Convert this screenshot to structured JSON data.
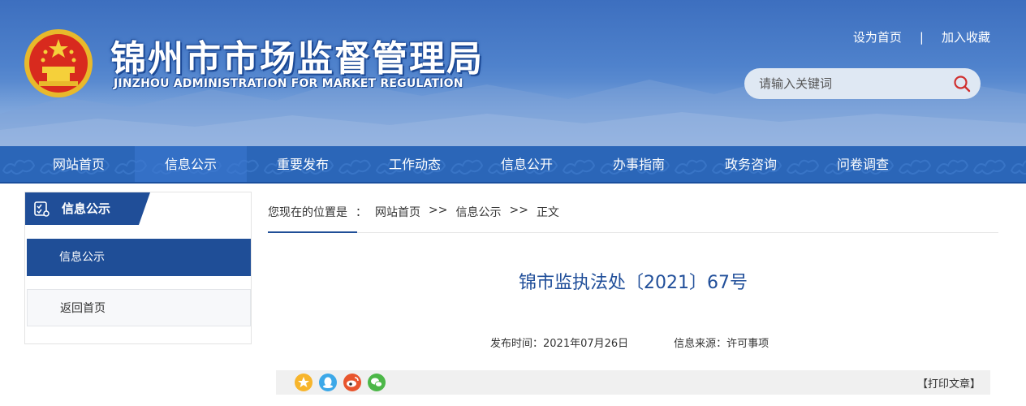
{
  "header": {
    "title": "锦州市市场监督管理局",
    "subtitle": "JINZHOU ADMINISTRATION FOR MARKET REGULATION",
    "links": [
      "设为首页",
      "|",
      "加入收藏"
    ],
    "search": {
      "placeholder": "请输入关键词",
      "icon": "search-icon"
    }
  },
  "nav": {
    "items": [
      "网站首页",
      "信息公示",
      "重要发布",
      "工作动态",
      "信息公开",
      "办事指南",
      "政务咨询",
      "问卷调查"
    ],
    "active_index": 1
  },
  "sidebar": {
    "heading": "信息公示",
    "heading_icon": "checklist-icon",
    "items": [
      "信息公示",
      "返回首页"
    ]
  },
  "breadcrumb": {
    "prefix": "您现在的位置是",
    "colon": "：",
    "items": [
      "网站首页",
      "信息公示",
      "正文"
    ],
    "separator": ">>"
  },
  "article": {
    "title": "锦市监执法处〔2021〕67号",
    "publish_time": "发布时间：2021年07月26日",
    "source": "信息来源：许可事项"
  },
  "share": {
    "icons": [
      "qzone-icon",
      "qq-icon",
      "weibo-icon",
      "wechat-icon"
    ],
    "print_label": "【打印文章】"
  },
  "colors": {
    "primary": "#1f4e97",
    "nav": "#2b66b8",
    "title": "#214f9a"
  }
}
